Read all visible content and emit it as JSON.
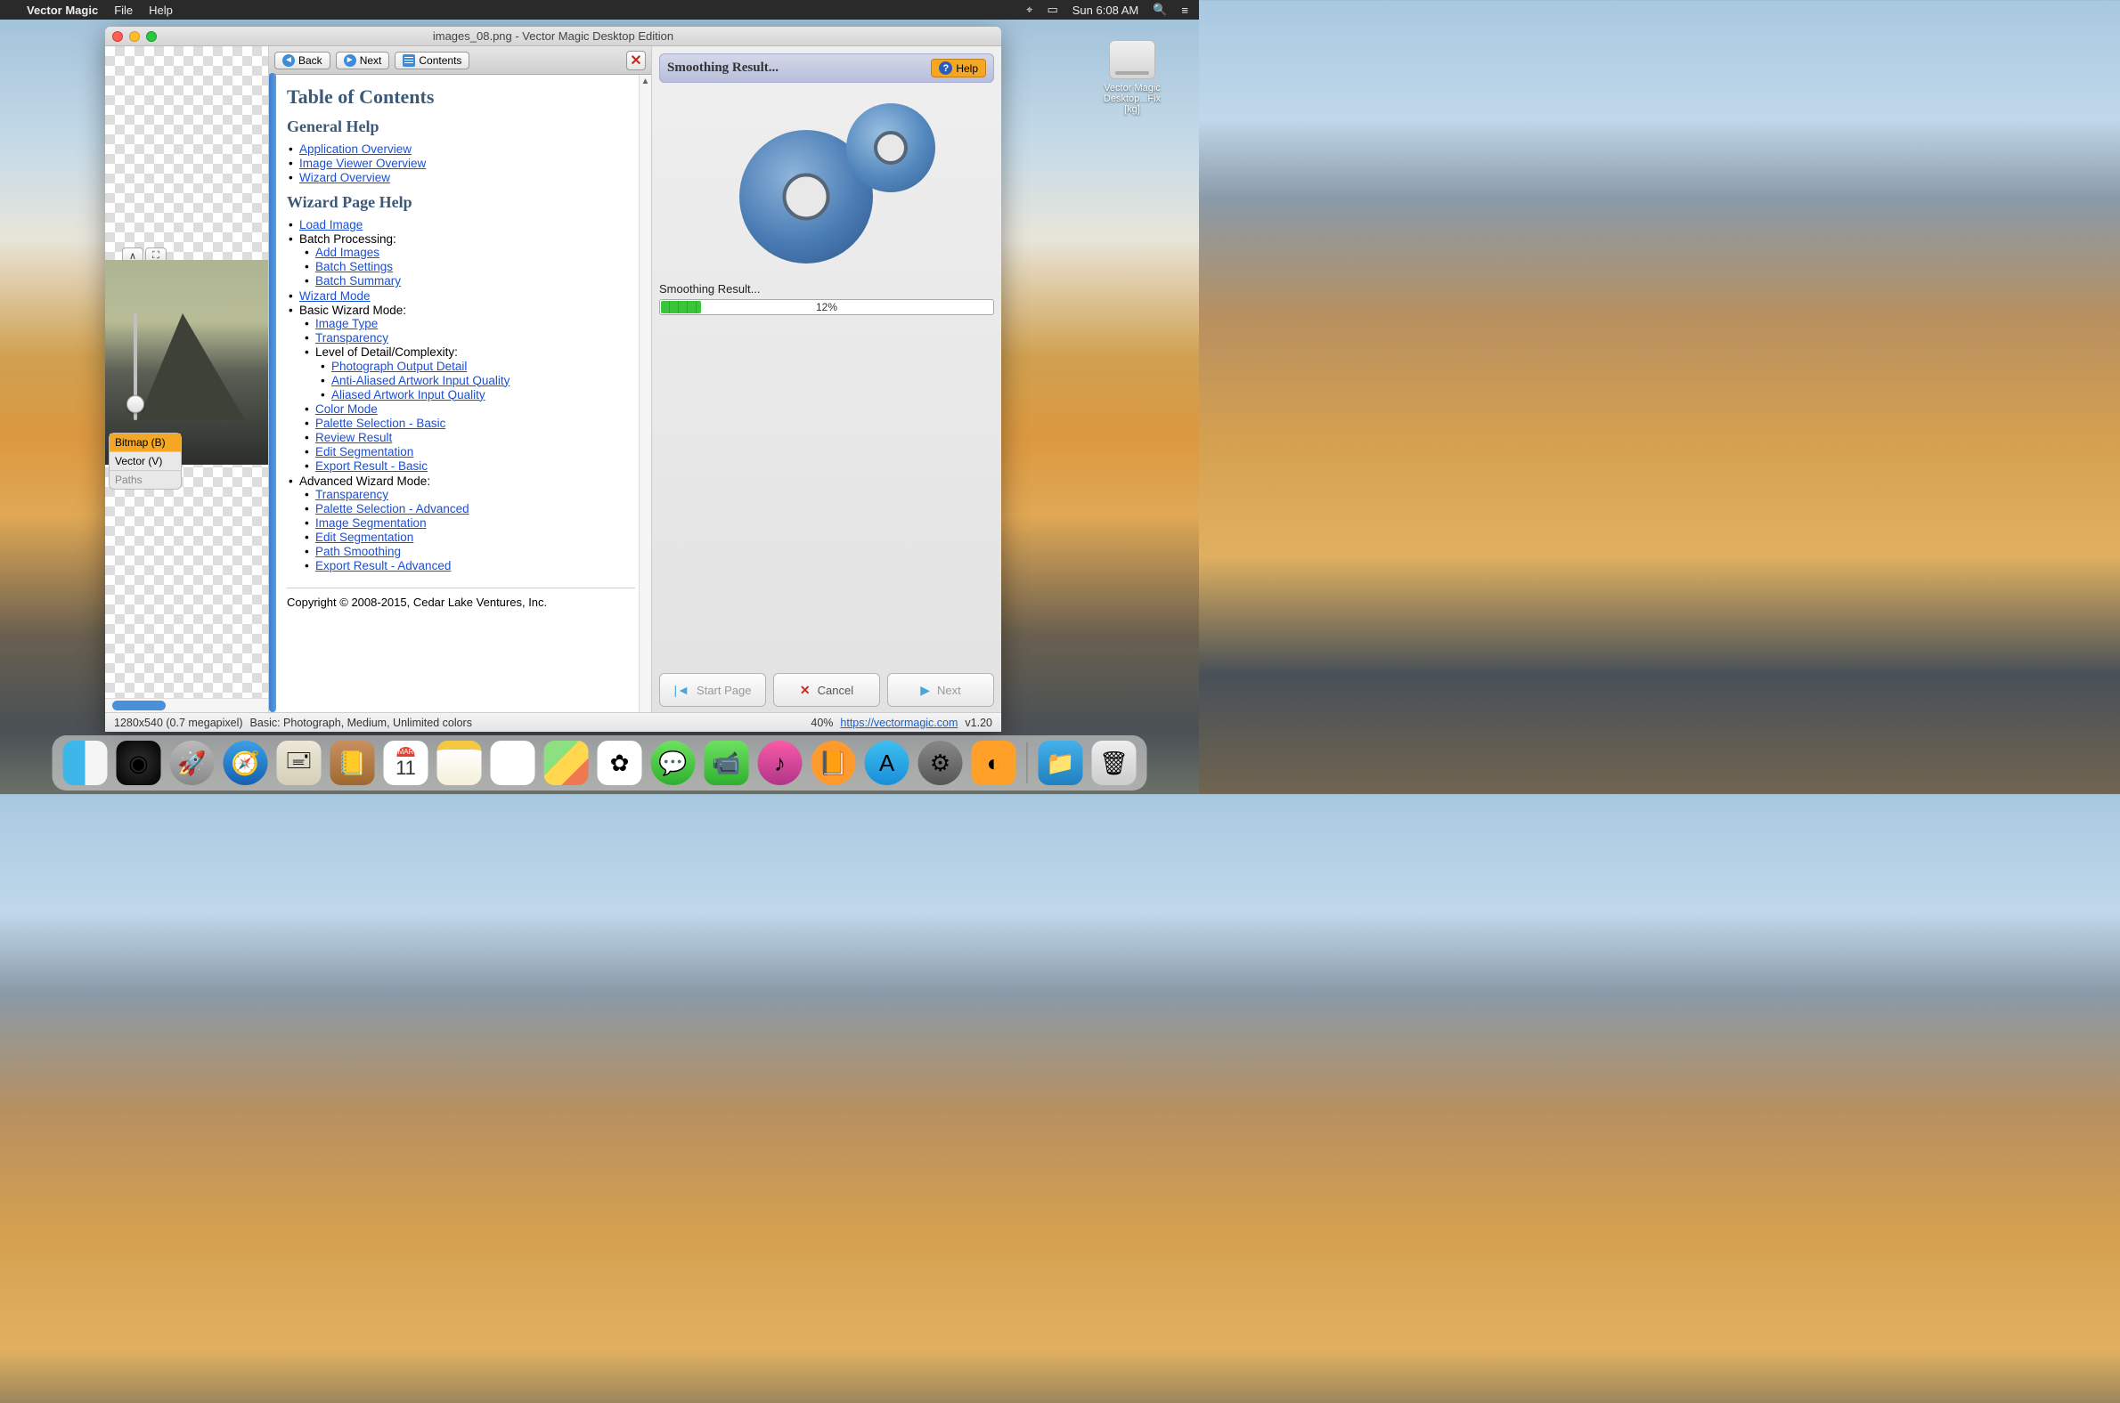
{
  "menubar": {
    "app": "Vector Magic",
    "items": [
      "File",
      "Help"
    ],
    "clock": "Sun 6:08 AM"
  },
  "desktop_icon": {
    "name": "Vector Magic Desktop...Fix [kg]"
  },
  "window": {
    "title": "images_08.png - Vector Magic Desktop Edition"
  },
  "viewer": {
    "toggle": {
      "bitmap": "Bitmap (B)",
      "vector": "Vector (V)",
      "paths": "Paths"
    }
  },
  "help_toolbar": {
    "back": "Back",
    "next": "Next",
    "contents": "Contents"
  },
  "help": {
    "h1": "Table of Contents",
    "general_heading": "General Help",
    "general": [
      "Application Overview",
      "Image Viewer Overview",
      "Wizard Overview"
    ],
    "wizard_heading": "Wizard Page Help",
    "load_image": "Load Image",
    "batch_processing": "Batch Processing:",
    "batch": [
      "Add Images",
      "Batch Settings",
      "Batch Summary"
    ],
    "wizard_mode": "Wizard Mode",
    "basic_wizard": "Basic Wizard Mode:",
    "basic": {
      "image_type": "Image Type",
      "transparency": "Transparency"
    },
    "lod": "Level of Detail/Complexity:",
    "lod_items": [
      "Photograph Output Detail",
      "Anti-Aliased Artwork Input Quality",
      "Aliased Artwork Input Quality"
    ],
    "color_mode": "Color Mode",
    "palette_basic": "Palette Selection - Basic",
    "review": "Review Result",
    "edit_seg": "Edit Segmentation",
    "export_basic": "Export Result - Basic",
    "adv_wizard": "Advanced Wizard Mode:",
    "adv": [
      "Transparency",
      "Palette Selection - Advanced",
      "Image Segmentation",
      "Edit Segmentation",
      "Path Smoothing",
      "Export Result - Advanced"
    ],
    "copyright": "Copyright © 2008-2015, Cedar Lake Ventures, Inc."
  },
  "progress": {
    "header": "Smoothing Result...",
    "help": "Help",
    "label": "Smoothing Result...",
    "percent": "12%"
  },
  "actions": {
    "start": "Start Page",
    "cancel": "Cancel",
    "next": "Next"
  },
  "status": {
    "dims": "1280x540 (0.7 megapixel)",
    "mode": "Basic: Photograph, Medium, Unlimited colors",
    "zoom": "40%",
    "url": "https://vectormagic.com",
    "version": "v1.20"
  },
  "dock_cal": {
    "month": "MAR",
    "day": "11"
  }
}
